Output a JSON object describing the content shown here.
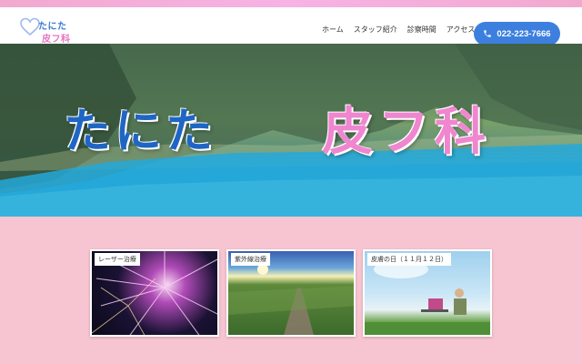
{
  "brand": {
    "line1": "たにた",
    "line2": "皮フ科"
  },
  "nav": {
    "items": [
      "ホーム",
      "スタッフ紹介",
      "診察時間",
      "アクセス"
    ]
  },
  "phone": {
    "number": "022-223-7666"
  },
  "hero": {
    "title_part1": "たにた",
    "title_part2": "皮フ科"
  },
  "cards": [
    {
      "label": "レーザー治療"
    },
    {
      "label": "紫外線治療"
    },
    {
      "label": "皮膚の日（１１月１２日）"
    }
  ],
  "colors": {
    "accent_blue": "#3d7fdf",
    "accent_pink": "#ef86cf",
    "background_pink": "#f7c5d1"
  }
}
